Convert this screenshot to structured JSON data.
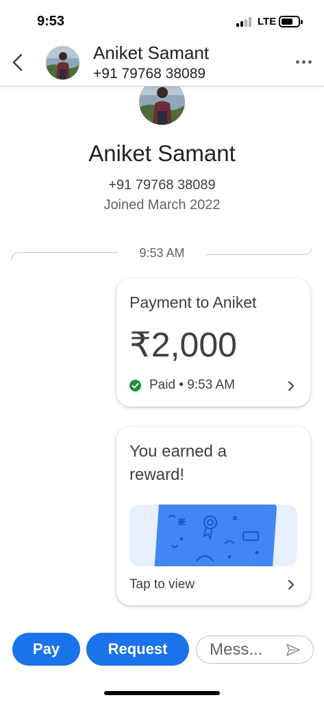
{
  "status_bar": {
    "time": "9:53",
    "network": "LTE",
    "icons": [
      "signal-icon",
      "battery-icon"
    ]
  },
  "header": {
    "contact_name": "Aniket Samant",
    "contact_phone": "+91 79768 38089",
    "icons": [
      "back-arrow-icon",
      "more-options-icon"
    ]
  },
  "profile": {
    "name": "Aniket Samant",
    "phone": "+91 79768 38089",
    "joined": "Joined March 2022"
  },
  "conversation": {
    "timestamp": "9:53 AM",
    "payment": {
      "title": "Payment to Aniket",
      "amount": "₹2,000",
      "status": "Paid • 9:53 AM",
      "status_color": "#1e8e3e"
    },
    "reward": {
      "title": "You earned a reward!",
      "action": "Tap to view"
    }
  },
  "bottom_bar": {
    "pay_label": "Pay",
    "request_label": "Request",
    "message_placeholder": "Mess...",
    "accent_color": "#1a73e8"
  }
}
